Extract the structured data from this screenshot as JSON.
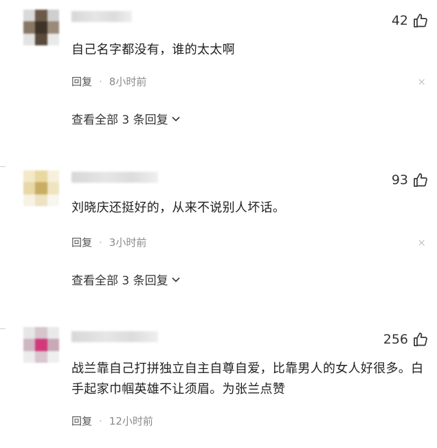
{
  "comments": [
    {
      "likes": "42",
      "text": "自己名字都没有，谁的太太啊",
      "reply_label": "回复",
      "separator": "·",
      "time": "8小时前",
      "view_all": "查看全部 3 条回复",
      "avatar_colors": [
        "#d9d9d9",
        "#6b5a4a",
        "#cfcfcf",
        "#8a7866",
        "#3f3226",
        "#9a8a7a",
        "#e3e3e3",
        "#5a4a3c",
        "#e9e9e9"
      ]
    },
    {
      "likes": "93",
      "text": "刘晓庆还挺好的，从来不说别人坏话。",
      "reply_label": "回复",
      "separator": "·",
      "time": "3小时前",
      "view_all": "查看全部 3 条回复",
      "avatar_colors": [
        "#f3e9c8",
        "#e9d9a0",
        "#f6f0dc",
        "#e7d8a6",
        "#c9ad62",
        "#efe4bf",
        "#f7f2e4",
        "#ede2c2",
        "#f9f6ee"
      ]
    },
    {
      "likes": "256",
      "text": "战兰靠自己打拼独立自主自尊自爱，比靠男人的女人好很多。白手起家巾帼英雄不让须眉。为张兰点赞",
      "reply_label": "回复",
      "separator": "·",
      "time": "12小时前",
      "view_all": "",
      "avatar_colors": [
        "#e6e6e6",
        "#d5c5cc",
        "#e9e9e9",
        "#cfb7c2",
        "#d2387a",
        "#c9a9b7",
        "#ececec",
        "#d9c6ce",
        "#efefef"
      ]
    }
  ],
  "icons": {
    "like": "thumbs-up-icon",
    "close": "close-icon",
    "expand": "chevron-down-icon"
  },
  "close_glyph": "×"
}
